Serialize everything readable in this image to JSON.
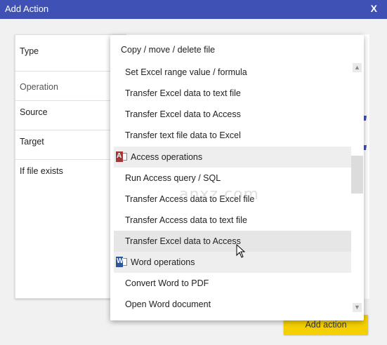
{
  "window": {
    "title": "Add Action",
    "close_label": "X"
  },
  "form": {
    "rows": [
      {
        "label": "Type"
      },
      {
        "label": "Operation"
      },
      {
        "label": "Source"
      },
      {
        "label": "Target"
      },
      {
        "label": "If file exists"
      }
    ]
  },
  "dropdown": {
    "selected": "Copy / move / delete file",
    "items": [
      {
        "label": "Set Excel range value / formula",
        "kind": "item"
      },
      {
        "label": "Transfer Excel data to text file",
        "kind": "item"
      },
      {
        "label": "Transfer Excel data to Access",
        "kind": "item"
      },
      {
        "label": "Transfer text file data to Excel",
        "kind": "item"
      },
      {
        "label": "Access operations",
        "kind": "group",
        "icon": "access-icon",
        "icon_color": "#a4373a",
        "icon_letter": "A"
      },
      {
        "label": "Run Access query / SQL",
        "kind": "item"
      },
      {
        "label": "Transfer Access data to Excel file",
        "kind": "item"
      },
      {
        "label": "Transfer Access data to text file",
        "kind": "item"
      },
      {
        "label": "Transfer Excel data to Access",
        "kind": "item",
        "hovered": true
      },
      {
        "label": "Word operations",
        "kind": "group",
        "icon": "word-icon",
        "icon_color": "#2b579a",
        "icon_letter": "W"
      },
      {
        "label": "Convert Word to PDF",
        "kind": "item"
      },
      {
        "label": "Open Word document",
        "kind": "item"
      }
    ]
  },
  "actions": {
    "add_label": "Add action"
  },
  "watermark": {
    "text": "anxz.com"
  },
  "colors": {
    "titlebar": "#3f51b5",
    "add_button": "#f5d000",
    "hover": "#e6e6e6",
    "group_bg": "#eeeeee"
  }
}
